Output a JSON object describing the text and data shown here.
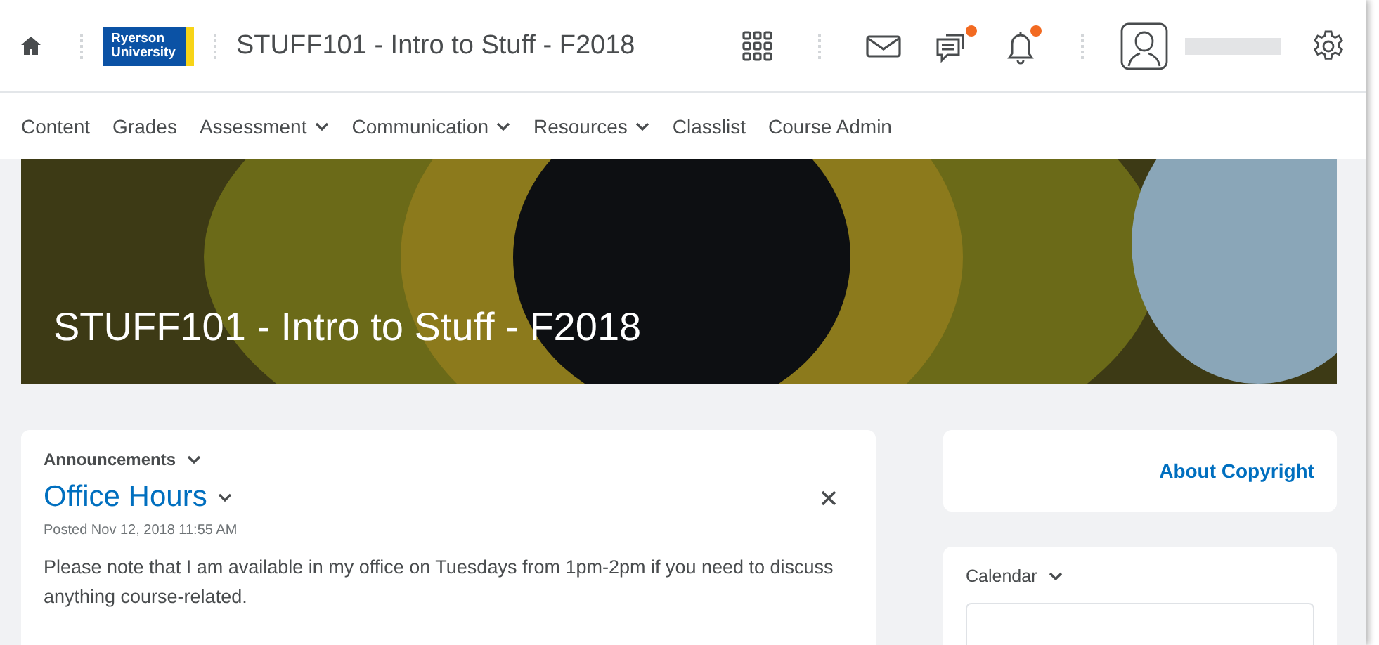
{
  "header": {
    "logo": [
      "Ryerson",
      "University"
    ],
    "course_title": "STUFF101 - Intro to Stuff - F2018",
    "icons": [
      {
        "kind": "grid",
        "badge": false
      },
      {
        "kind": "mail",
        "badge": false
      },
      {
        "kind": "chat",
        "badge": true
      },
      {
        "kind": "bell",
        "badge": true
      }
    ]
  },
  "nav": [
    {
      "label": "Content",
      "dropdown": false
    },
    {
      "label": "Grades",
      "dropdown": false
    },
    {
      "label": "Assessment",
      "dropdown": true
    },
    {
      "label": "Communication",
      "dropdown": true
    },
    {
      "label": "Resources",
      "dropdown": true
    },
    {
      "label": "Classlist",
      "dropdown": false
    },
    {
      "label": "Course Admin",
      "dropdown": false
    }
  ],
  "banner": {
    "title": "STUFF101 - Intro to Stuff - F2018"
  },
  "announcements": {
    "heading": "Announcements",
    "title": "Office Hours",
    "posted": "Posted Nov 12, 2018 11:55 AM",
    "body": "Please note that I am available in my office on Tuesdays from 1pm-2pm if you need to discuss anything course-related."
  },
  "copyright": {
    "link": "About Copyright"
  },
  "calendar": {
    "heading": "Calendar"
  }
}
